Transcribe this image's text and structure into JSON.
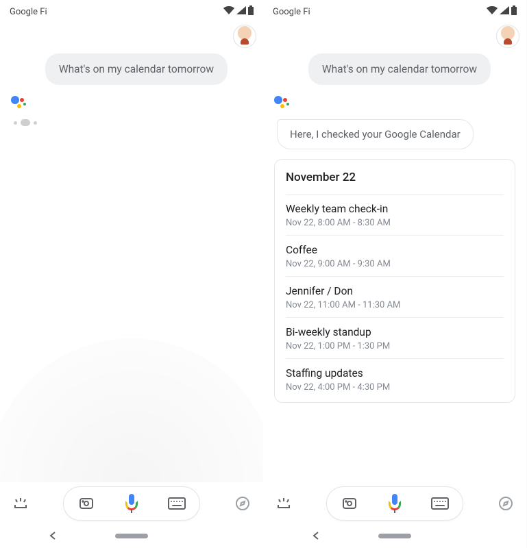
{
  "status": {
    "carrier": "Google Fi"
  },
  "conversation": {
    "user_query": "What's on my calendar tomorrow",
    "assistant_reply": "Here, I checked your Google Calendar"
  },
  "calendar": {
    "date_header": "November 22",
    "events": [
      {
        "title": "Weekly team check-in",
        "time": "Nov 22, 8:00 AM - 8:30 AM"
      },
      {
        "title": "Coffee",
        "time": "Nov 22, 9:00 AM - 9:30 AM"
      },
      {
        "title": "Jennifer / Don",
        "time": "Nov 22, 11:00 AM - 11:30 AM"
      },
      {
        "title": "Bi-weekly standup",
        "time": "Nov 22, 1:00 PM - 1:30 PM"
      },
      {
        "title": "Staffing updates",
        "time": "Nov 22, 4:00 PM - 4:30 PM"
      }
    ]
  }
}
